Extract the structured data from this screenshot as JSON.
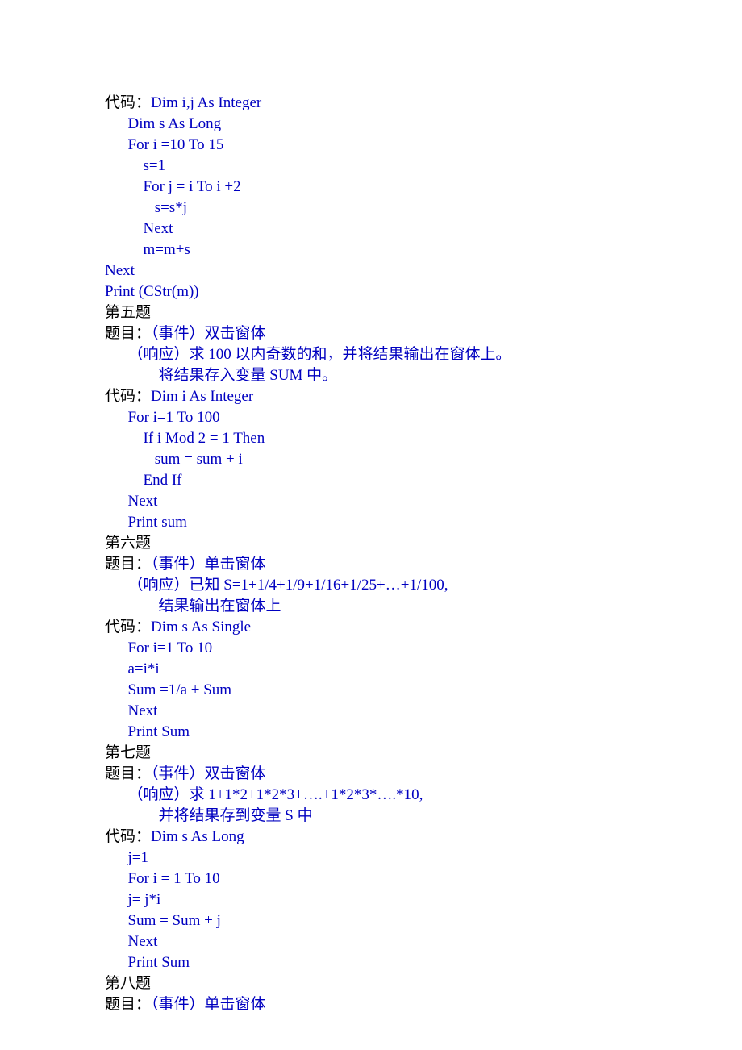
{
  "lines": [
    {
      "class": "black",
      "text": "代码：",
      "cont": {
        "class": "blue",
        "text": "Dim i,j As Integer"
      }
    },
    {
      "class": "blue",
      "text": "      Dim s As Long"
    },
    {
      "class": "blue",
      "text": "      For i =10 To 15"
    },
    {
      "class": "blue",
      "text": "          s=1"
    },
    {
      "class": "blue",
      "text": "          For j = i To i +2"
    },
    {
      "class": "blue",
      "text": "             s=s*j"
    },
    {
      "class": "blue",
      "text": "          Next"
    },
    {
      "class": "blue",
      "text": "          m=m+s"
    },
    {
      "class": "blue",
      "text": "Next"
    },
    {
      "class": "blue",
      "text": "Print (CStr(m))"
    },
    {
      "class": "black",
      "text": "第五题"
    },
    {
      "class": "black",
      "text": "题目：",
      "cont": {
        "class": "blue",
        "text": "（事件）双击窗体"
      }
    },
    {
      "class": "blue",
      "text": "      （响应）求 100 以内奇数的和，并将结果输出在窗体上。"
    },
    {
      "class": "blue",
      "text": "              将结果存入变量 SUM 中。"
    },
    {
      "class": "black",
      "text": "代码：",
      "cont": {
        "class": "blue",
        "text": "Dim i As Integer"
      }
    },
    {
      "class": "blue",
      "text": "      For i=1 To 100"
    },
    {
      "class": "blue",
      "text": "          If i Mod 2 = 1 Then"
    },
    {
      "class": "blue",
      "text": "             sum = sum + i"
    },
    {
      "class": "blue",
      "text": "          End If"
    },
    {
      "class": "blue",
      "text": "      Next"
    },
    {
      "class": "blue",
      "text": "      Print sum"
    },
    {
      "class": "black",
      "text": "第六题"
    },
    {
      "class": "black",
      "text": "题目：",
      "cont": {
        "class": "blue",
        "text": "（事件）单击窗体"
      }
    },
    {
      "class": "blue",
      "text": "      （响应）已知 S=1+1/4+1/9+1/16+1/25+…+1/100,"
    },
    {
      "class": "blue",
      "text": "              结果输出在窗体上"
    },
    {
      "class": "black",
      "text": "代码：",
      "cont": {
        "class": "blue",
        "text": "Dim s As Single"
      }
    },
    {
      "class": "blue",
      "text": "      For i=1 To 10"
    },
    {
      "class": "blue",
      "text": "      a=i*i"
    },
    {
      "class": "blue",
      "text": "      Sum =1/a + Sum"
    },
    {
      "class": "blue",
      "text": "      Next"
    },
    {
      "class": "blue",
      "text": "      Print Sum"
    },
    {
      "class": "black",
      "text": "第七题"
    },
    {
      "class": "black",
      "text": "题目：",
      "cont": {
        "class": "blue",
        "text": "（事件）双击窗体"
      }
    },
    {
      "class": "blue",
      "text": "      （响应）求 1+1*2+1*2*3+….+1*2*3*….*10,"
    },
    {
      "class": "blue",
      "text": "              并将结果存到变量 S 中"
    },
    {
      "class": "black",
      "text": "代码：",
      "cont": {
        "class": "blue",
        "text": "Dim s As Long"
      }
    },
    {
      "class": "blue",
      "text": "      j=1"
    },
    {
      "class": "blue",
      "text": "      For i = 1 To 10"
    },
    {
      "class": "blue",
      "text": "      j= j*i"
    },
    {
      "class": "blue",
      "text": "      Sum = Sum + j"
    },
    {
      "class": "blue",
      "text": "      Next"
    },
    {
      "class": "blue",
      "text": "      Print Sum"
    },
    {
      "class": "black",
      "text": "第八题"
    },
    {
      "class": "black",
      "text": "题目：",
      "cont": {
        "class": "blue",
        "text": "（事件）单击窗体"
      }
    }
  ]
}
